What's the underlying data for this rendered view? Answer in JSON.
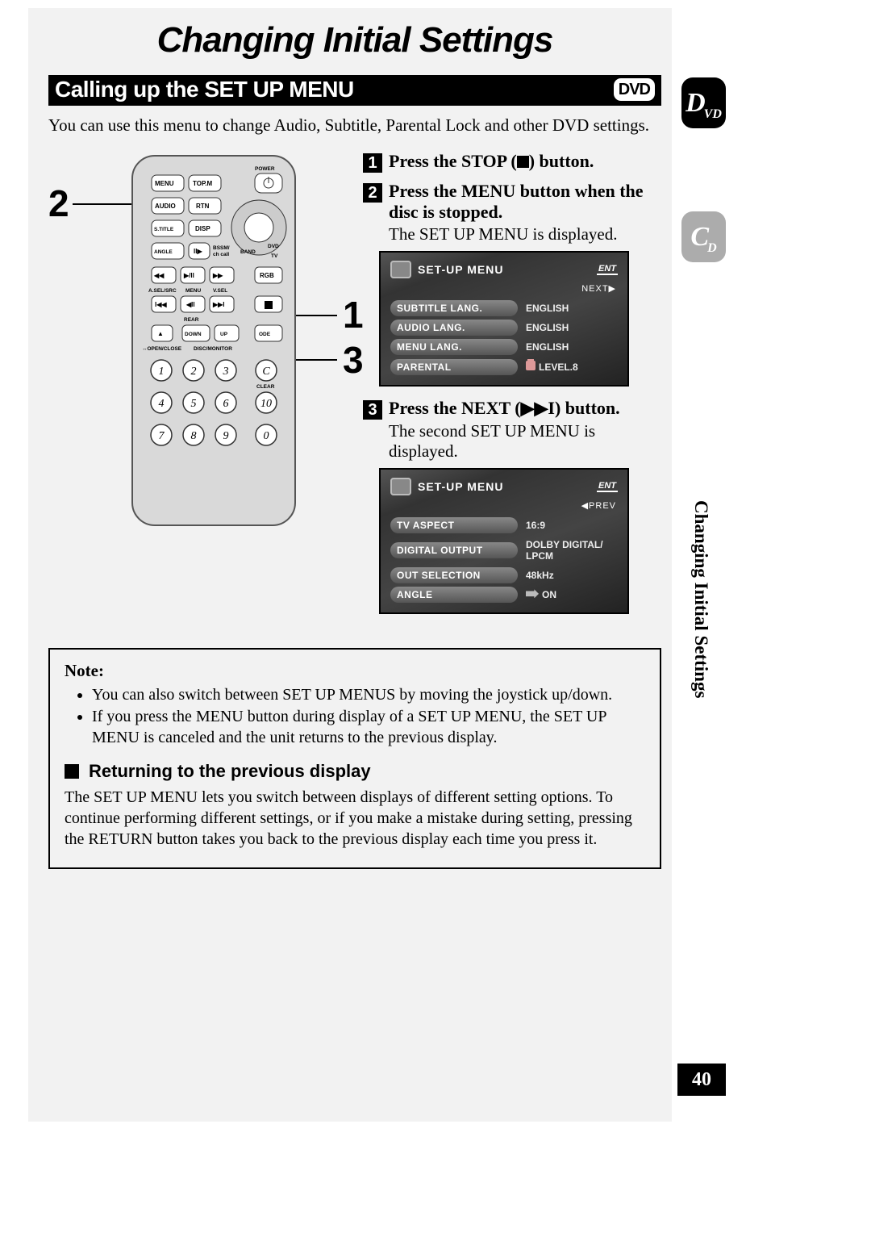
{
  "page_title": "Changing Initial Settings",
  "section_bar": {
    "title": "Calling up the SET UP MENU",
    "badge": "DVD"
  },
  "intro": "You can use this menu to change Audio, Subtitle, Parental Lock and other DVD settings.",
  "callouts": {
    "left": "2",
    "right_upper": "1",
    "right_lower": "3"
  },
  "remote": {
    "row1": [
      "MENU",
      "TOP.M"
    ],
    "power_label": "POWER",
    "row2": [
      "AUDIO",
      "RTN"
    ],
    "row3": [
      "S.TITLE",
      "DISP"
    ],
    "row4_left": "ANGLE",
    "row4_mid": "II▶",
    "row4_bssm1": "BSSM/",
    "row4_bssm2": "ch call",
    "row4_band": "BAND",
    "row4_dvd": "DVD",
    "row4_tv": "TV",
    "nav_labels": {
      "asel": "A.SEL/SRC",
      "menu": "MENU",
      "vsel": "V.SEL",
      "rgb": "RGB",
      "rear": "REAR"
    },
    "btn_open": "↔OPEN/CLOSE",
    "btn_disc": "DISC/MONITOR",
    "dir": [
      "DOWN",
      "UP"
    ],
    "clear": "CLEAR",
    "keypad": [
      "1",
      "2",
      "3",
      "C",
      "4",
      "5",
      "6",
      "10",
      "7",
      "8",
      "9",
      "0"
    ]
  },
  "steps": [
    {
      "n": "1",
      "head_pre": "Press the STOP (",
      "head_post": ") button."
    },
    {
      "n": "2",
      "head": "Press the MENU button when the disc is stopped.",
      "body": "The SET UP MENU is displayed."
    },
    {
      "n": "3",
      "head_pre": "Press the NEXT (",
      "head_post": ") button.",
      "body": "The second SET UP MENU is displayed."
    }
  ],
  "osd_common": {
    "title": "SET-UP MENU",
    "ent": "ENT",
    "next": "NEXT▶",
    "prev": "◀PREV"
  },
  "osd1_rows": [
    {
      "label": "SUBTITLE LANG.",
      "value": "ENGLISH"
    },
    {
      "label": "AUDIO LANG.",
      "value": "ENGLISH"
    },
    {
      "label": "MENU LANG.",
      "value": "ENGLISH"
    },
    {
      "label": "PARENTAL",
      "value": "LEVEL.8",
      "icon": "lock"
    }
  ],
  "osd2_rows": [
    {
      "label": "TV ASPECT",
      "value": "16:9"
    },
    {
      "label": "DIGITAL OUTPUT",
      "value": "DOLBY DIGITAL/ LPCM"
    },
    {
      "label": "OUT SELECTION",
      "value": "48kHz"
    },
    {
      "label": "ANGLE",
      "value": "ON",
      "icon": "camera"
    }
  ],
  "note": {
    "title": "Note:",
    "items": [
      "You can also switch between SET UP MENUS by moving the joystick up/down.",
      "If you press the MENU button during display of a SET UP MENU, the SET UP MENU is canceled and the unit returns to the previous display."
    ],
    "sub_heading": "Returning to the previous display",
    "sub_body": "The SET UP MENU lets you switch between displays of different setting options. To continue performing different settings, or if you make a mistake during setting, pressing the RETURN button takes you back to the previous display each time you press it."
  },
  "sidebar": {
    "tab_dvd": {
      "big": "D",
      "sub": "VD"
    },
    "tab_cd": {
      "big": "C",
      "sub": "D"
    },
    "section_label": "Changing Initial Settings",
    "page_number": "40"
  }
}
